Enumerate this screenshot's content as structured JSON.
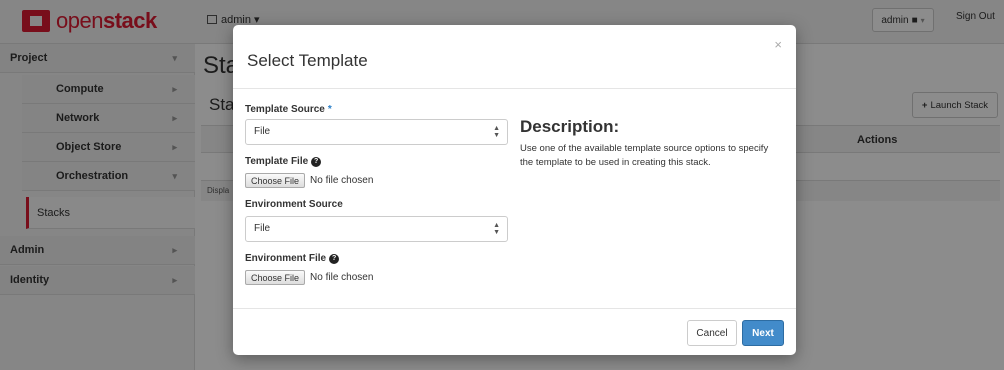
{
  "app": {
    "logo_text_light": "open",
    "logo_text_bold": "stack",
    "project_label": "admin ▾",
    "user_label": "admin",
    "signout_label": "Sign Out",
    "brand_color": "#da1a32"
  },
  "sidebar": {
    "items": [
      {
        "label": "Project",
        "level": 1
      },
      {
        "label": "Compute",
        "level": 2
      },
      {
        "label": "Network",
        "level": 2
      },
      {
        "label": "Object Store",
        "level": 2
      },
      {
        "label": "Orchestration",
        "level": 2
      },
      {
        "label": "Stacks",
        "level": 3
      },
      {
        "label": "Admin",
        "level": 1
      },
      {
        "label": "Identity",
        "level": 1
      }
    ]
  },
  "page": {
    "title": "Sta",
    "subtitle": "Sta",
    "launch_label": "Launch Stack",
    "actions_header": "Actions",
    "footer_text": "Displa"
  },
  "modal": {
    "title": "Select Template",
    "close_glyph": "×",
    "template_source_label": "Template Source",
    "required_marker": "*",
    "template_source_value": "File",
    "template_file_label": "Template File",
    "choose_file_label": "Choose File",
    "no_file_text": "No file chosen",
    "environment_source_label": "Environment Source",
    "environment_source_value": "File",
    "environment_file_label": "Environment File",
    "description_title": "Description:",
    "description_text": "Use one of the available template source options to specify the template to be used in creating this stack.",
    "cancel_label": "Cancel",
    "next_label": "Next",
    "primary_color": "#428bca"
  }
}
